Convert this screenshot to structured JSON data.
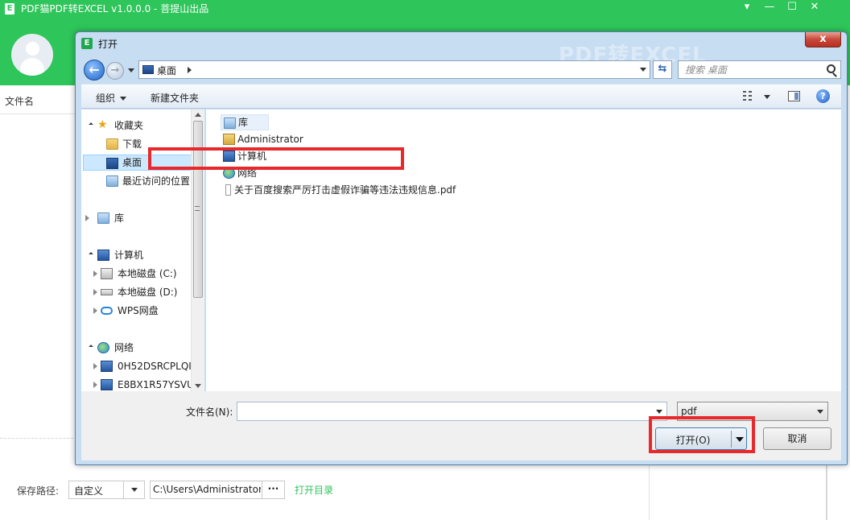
{
  "app": {
    "title": "PDF猫PDF转EXCEL v1.0.0.0 - 菩提山出品",
    "column_header": "文件名",
    "save_label": "保存路径:",
    "save_mode": "自定义",
    "save_path": "C:\\Users\\Administrator",
    "more_label": "···",
    "open_dir_link": "打开目录",
    "brand_color": "#2ec55a"
  },
  "dialog": {
    "title": "打开",
    "watermark": "PDF转EXCEL",
    "close_label": "x",
    "address": "桌面",
    "search_placeholder": "搜索 桌面",
    "toolbar": {
      "organize": "组织",
      "new_folder": "新建文件夹",
      "help": "?"
    },
    "nav": {
      "favorites": "收藏夹",
      "downloads": "下载",
      "desktop": "桌面",
      "recent": "最近访问的位置",
      "libraries": "库",
      "computer": "计算机",
      "drive_c": "本地磁盘 (C:)",
      "drive_d": "本地磁盘 (D:)",
      "wps": "WPS网盘",
      "network": "网络",
      "host1": "0H52DSRCPLQI",
      "host2": "E8BX1R57YSVU"
    },
    "files": [
      {
        "name": "库",
        "icon": "library-icon"
      },
      {
        "name": "Administrator",
        "icon": "user-folder-icon"
      },
      {
        "name": "计算机",
        "icon": "computer-icon"
      },
      {
        "name": "网络",
        "icon": "network-icon"
      },
      {
        "name": "关于百度搜索严厉打击虚假诈骗等违法违规信息.pdf",
        "icon": "pdf-file-icon"
      }
    ],
    "filename_label": "文件名(N):",
    "filename_value": "",
    "filetype": "pdf",
    "open_button": "打开(O)",
    "cancel_button": "取消",
    "highlight_color": "#e8282b"
  }
}
